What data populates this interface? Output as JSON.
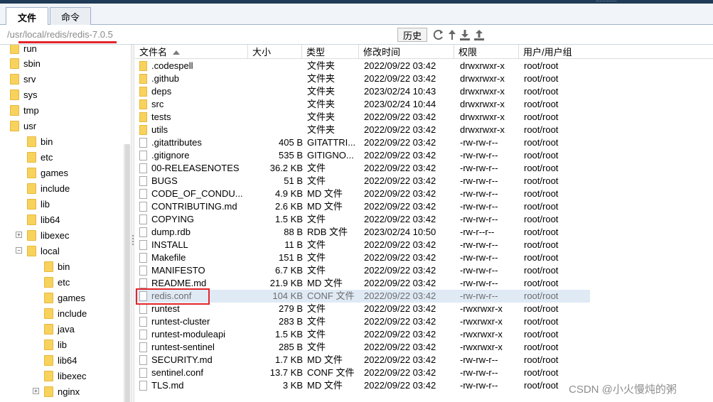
{
  "tabs": [
    {
      "label": "文件",
      "active": true
    },
    {
      "label": "命令",
      "active": false
    }
  ],
  "pathbar": {
    "path": "/usr/local/redis/redis-7.0.5",
    "history_label": "历史",
    "icons": [
      "refresh-icon",
      "up-icon",
      "download-icon",
      "upload-icon"
    ]
  },
  "tree": [
    {
      "label": "run"
    },
    {
      "label": "sbin"
    },
    {
      "label": "srv"
    },
    {
      "label": "sys"
    },
    {
      "label": "tmp"
    },
    {
      "label": "usr"
    },
    {
      "label": "bin"
    },
    {
      "label": "etc"
    },
    {
      "label": "games"
    },
    {
      "label": "include"
    },
    {
      "label": "lib"
    },
    {
      "label": "lib64"
    },
    {
      "label": "libexec"
    },
    {
      "label": "local"
    },
    {
      "label": "bin"
    },
    {
      "label": "etc"
    },
    {
      "label": "games"
    },
    {
      "label": "include"
    },
    {
      "label": "java"
    },
    {
      "label": "lib"
    },
    {
      "label": "lib64"
    },
    {
      "label": "libexec"
    },
    {
      "label": "nginx"
    }
  ],
  "columns": [
    "文件名",
    "大小",
    "类型",
    "修改时间",
    "权限",
    "用户/用户组"
  ],
  "files": [
    {
      "name": ".codespell",
      "size": "",
      "type": "文件夹",
      "time": "2022/09/22 03:42",
      "perm": "drwxrwxr-x",
      "owner": "root/root"
    },
    {
      "name": ".github",
      "size": "",
      "type": "文件夹",
      "time": "2022/09/22 03:42",
      "perm": "drwxrwxr-x",
      "owner": "root/root"
    },
    {
      "name": "deps",
      "size": "",
      "type": "文件夹",
      "time": "2023/02/24 10:43",
      "perm": "drwxrwxr-x",
      "owner": "root/root"
    },
    {
      "name": "src",
      "size": "",
      "type": "文件夹",
      "time": "2023/02/24 10:44",
      "perm": "drwxrwxr-x",
      "owner": "root/root"
    },
    {
      "name": "tests",
      "size": "",
      "type": "文件夹",
      "time": "2022/09/22 03:42",
      "perm": "drwxrwxr-x",
      "owner": "root/root"
    },
    {
      "name": "utils",
      "size": "",
      "type": "文件夹",
      "time": "2022/09/22 03:42",
      "perm": "drwxrwxr-x",
      "owner": "root/root"
    },
    {
      "name": ".gitattributes",
      "size": "405 B",
      "type": "GITATTRI...",
      "time": "2022/09/22 03:42",
      "perm": "-rw-rw-r--",
      "owner": "root/root"
    },
    {
      "name": ".gitignore",
      "size": "535 B",
      "type": "GITIGNO...",
      "time": "2022/09/22 03:42",
      "perm": "-rw-rw-r--",
      "owner": "root/root"
    },
    {
      "name": "00-RELEASENOTES",
      "size": "36.2 KB",
      "type": "文件",
      "time": "2022/09/22 03:42",
      "perm": "-rw-rw-r--",
      "owner": "root/root"
    },
    {
      "name": "BUGS",
      "size": "51 B",
      "type": "文件",
      "time": "2022/09/22 03:42",
      "perm": "-rw-rw-r--",
      "owner": "root/root"
    },
    {
      "name": "CODE_OF_CONDU...",
      "size": "4.9 KB",
      "type": "MD 文件",
      "time": "2022/09/22 03:42",
      "perm": "-rw-rw-r--",
      "owner": "root/root"
    },
    {
      "name": "CONTRIBUTING.md",
      "size": "2.6 KB",
      "type": "MD 文件",
      "time": "2022/09/22 03:42",
      "perm": "-rw-rw-r--",
      "owner": "root/root"
    },
    {
      "name": "COPYING",
      "size": "1.5 KB",
      "type": "文件",
      "time": "2022/09/22 03:42",
      "perm": "-rw-rw-r--",
      "owner": "root/root"
    },
    {
      "name": "dump.rdb",
      "size": "88 B",
      "type": "RDB 文件",
      "time": "2023/02/24 10:50",
      "perm": "-rw-r--r--",
      "owner": "root/root"
    },
    {
      "name": "INSTALL",
      "size": "11 B",
      "type": "文件",
      "time": "2022/09/22 03:42",
      "perm": "-rw-rw-r--",
      "owner": "root/root"
    },
    {
      "name": "Makefile",
      "size": "151 B",
      "type": "文件",
      "time": "2022/09/22 03:42",
      "perm": "-rw-rw-r--",
      "owner": "root/root"
    },
    {
      "name": "MANIFESTO",
      "size": "6.7 KB",
      "type": "文件",
      "time": "2022/09/22 03:42",
      "perm": "-rw-rw-r--",
      "owner": "root/root"
    },
    {
      "name": "README.md",
      "size": "21.9 KB",
      "type": "MD 文件",
      "time": "2022/09/22 03:42",
      "perm": "-rw-rw-r--",
      "owner": "root/root"
    },
    {
      "name": "redis.conf",
      "size": "104 KB",
      "type": "CONF 文件",
      "time": "2022/09/22 03:42",
      "perm": "-rw-rw-r--",
      "owner": "root/root"
    },
    {
      "name": "runtest",
      "size": "279 B",
      "type": "文件",
      "time": "2022/09/22 03:42",
      "perm": "-rwxrwxr-x",
      "owner": "root/root"
    },
    {
      "name": "runtest-cluster",
      "size": "283 B",
      "type": "文件",
      "time": "2022/09/22 03:42",
      "perm": "-rwxrwxr-x",
      "owner": "root/root"
    },
    {
      "name": "runtest-moduleapi",
      "size": "1.5 KB",
      "type": "文件",
      "time": "2022/09/22 03:42",
      "perm": "-rwxrwxr-x",
      "owner": "root/root"
    },
    {
      "name": "runtest-sentinel",
      "size": "285 B",
      "type": "文件",
      "time": "2022/09/22 03:42",
      "perm": "-rwxrwxr-x",
      "owner": "root/root"
    },
    {
      "name": "SECURITY.md",
      "size": "1.7 KB",
      "type": "MD 文件",
      "time": "2022/09/22 03:42",
      "perm": "-rw-rw-r--",
      "owner": "root/root"
    },
    {
      "name": "sentinel.conf",
      "size": "13.7 KB",
      "type": "CONF 文件",
      "time": "2022/09/22 03:42",
      "perm": "-rw-rw-r--",
      "owner": "root/root"
    },
    {
      "name": "TLS.md",
      "size": "3 KB",
      "type": "MD 文件",
      "time": "2022/09/22 03:42",
      "perm": "-rw-rw-r--",
      "owner": "root/root"
    }
  ],
  "selected_file": "redis.conf",
  "watermark": "CSDN @小火慢炖的粥",
  "colors": {
    "highlight": "#e3252a",
    "selected_row": "#dfeaf5",
    "folder": "#f7d35d"
  }
}
